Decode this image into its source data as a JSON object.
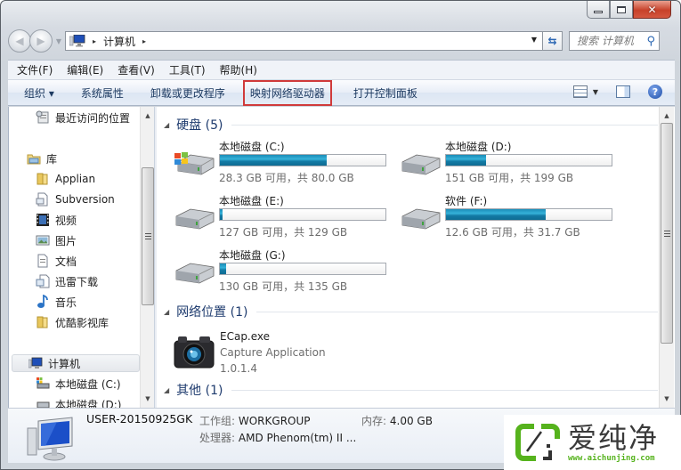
{
  "window": {
    "caption_buttons": {
      "minimize": "minimize",
      "maximize": "maximize",
      "close": "✕"
    }
  },
  "address_bar": {
    "back_icon": "back-arrow",
    "forward_icon": "forward-arrow",
    "breadcrumb": [
      "计算机"
    ],
    "separator": "▸",
    "refresh_icon": "refresh-arrows"
  },
  "search": {
    "placeholder": "搜索 计算机",
    "icon": "⚲"
  },
  "menubar": {
    "items": [
      "文件(F)",
      "编辑(E)",
      "查看(V)",
      "工具(T)",
      "帮助(H)"
    ]
  },
  "commandbar": {
    "organize": "组织 ▾",
    "items": [
      "系统属性",
      "卸载或更改程序",
      "映射网络驱动器",
      "打开控制面板"
    ],
    "highlighted_index": 2,
    "help_icon": "?"
  },
  "nav_pane": {
    "items": [
      {
        "label": "最近访问的位置",
        "icon": "recent-places"
      },
      {
        "label": "库",
        "icon": "libraries"
      },
      {
        "label": "Applian",
        "icon": "folder"
      },
      {
        "label": "Subversion",
        "icon": "document"
      },
      {
        "label": "视频",
        "icon": "video"
      },
      {
        "label": "图片",
        "icon": "pictures"
      },
      {
        "label": "文档",
        "icon": "documents"
      },
      {
        "label": "迅雷下载",
        "icon": "document"
      },
      {
        "label": "音乐",
        "icon": "music"
      },
      {
        "label": "优酷影视库",
        "icon": "folder"
      },
      {
        "label": "计算机",
        "icon": "computer",
        "selected": true
      },
      {
        "label": "本地磁盘 (C:)",
        "icon": "system-drive"
      },
      {
        "label": "本地磁盘 (D:)",
        "icon": "drive"
      }
    ]
  },
  "content": {
    "groups": [
      {
        "title": "硬盘 (5)"
      },
      {
        "title": "网络位置 (1)"
      },
      {
        "title": "其他 (1)"
      }
    ],
    "drives": [
      {
        "name": "本地磁盘 (C:)",
        "free": "28.3 GB 可用，共 80.0 GB",
        "used_fraction": 0.646,
        "system": true
      },
      {
        "name": "本地磁盘 (D:)",
        "free": "151 GB 可用，共 199 GB",
        "used_fraction": 0.241,
        "system": false
      },
      {
        "name": "本地磁盘 (E:)",
        "free": "127 GB 可用，共 129 GB",
        "used_fraction": 0.016,
        "system": false
      },
      {
        "name": "软件 (F:)",
        "free": "12.6 GB 可用，共 31.7 GB",
        "used_fraction": 0.603,
        "system": false
      },
      {
        "name": "本地磁盘 (G:)",
        "free": "130 GB 可用，共 135 GB",
        "used_fraction": 0.037,
        "system": false
      }
    ],
    "network_item": {
      "name": "ECap.exe",
      "description": "Capture Application",
      "version": "1.0.1.4"
    }
  },
  "details": {
    "computer_name": "USER-20150925GK",
    "workgroup_label": "工作组:",
    "workgroup": "WORKGROUP",
    "memory_label": "内存:",
    "memory": "4.00 GB",
    "processor_label": "处理器:",
    "processor": "AMD Phenom(tm) II ..."
  },
  "watermark": {
    "brand": "爱纯净",
    "url": "www.aichunjing.com",
    "brand_color": "#56b31d"
  }
}
